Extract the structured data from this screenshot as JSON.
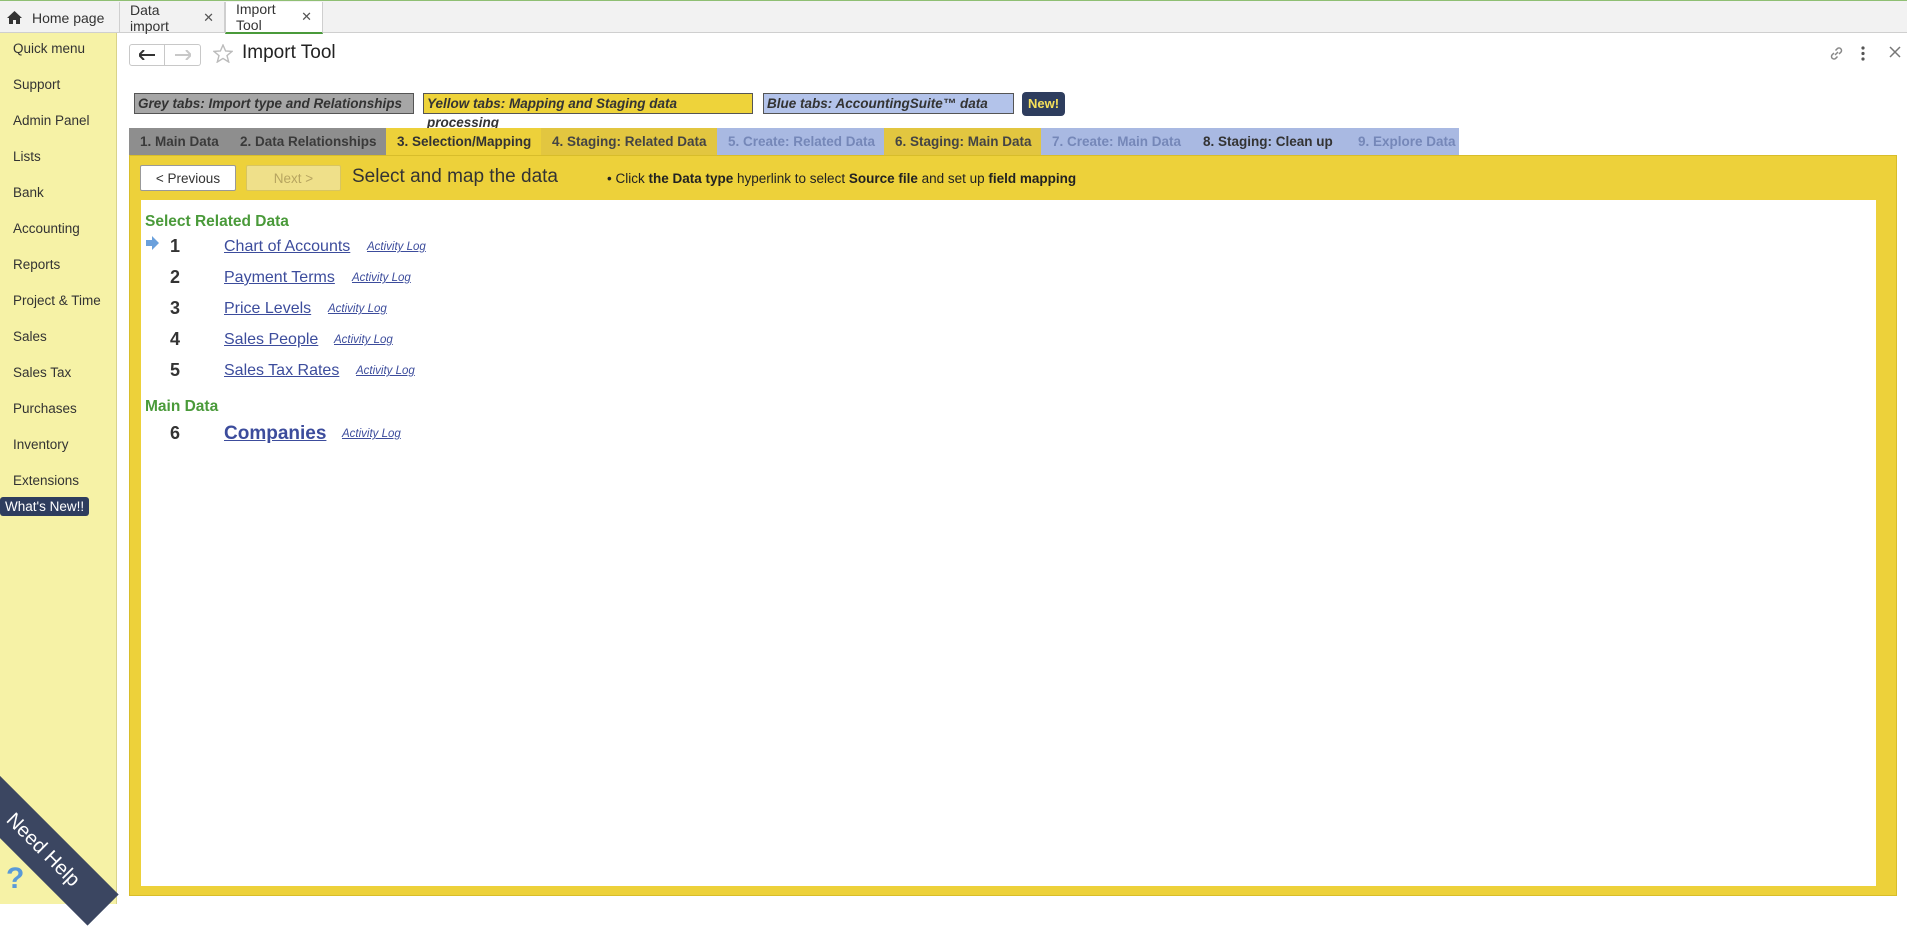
{
  "top_tabs": [
    {
      "label": "Home page"
    },
    {
      "label": "Data import"
    },
    {
      "label": "Import Tool"
    }
  ],
  "sidebar": {
    "items": [
      "Quick menu",
      "Support",
      "Admin Panel",
      "Lists",
      "Bank",
      "Accounting",
      "Reports",
      "Project & Time",
      "Sales",
      "Sales Tax",
      "Purchases",
      "Inventory",
      "Extensions"
    ],
    "whats_new": "What's New!!",
    "need_help": "Need Help",
    "need_help_icon": "?"
  },
  "header": {
    "title": "Import Tool"
  },
  "legend": {
    "grey": "Grey tabs: Import type and Relationships",
    "yellow": "Yellow tabs: Mapping and Staging data processing",
    "blue": "Blue tabs: AccountingSuite™ data",
    "new_badge": "New!"
  },
  "steps": [
    {
      "label": "1. Main Data"
    },
    {
      "label": "2. Data Relationships"
    },
    {
      "label": "3. Selection/Mapping"
    },
    {
      "label": "4. Staging: Related Data"
    },
    {
      "label": "5. Create: Related Data"
    },
    {
      "label": "6. Staging: Main Data"
    },
    {
      "label": "7. Create: Main Data"
    },
    {
      "label": "8. Staging: Clean up"
    },
    {
      "label": "9. Explore Data"
    }
  ],
  "toolbar": {
    "previous_label": "< Previous",
    "next_label": "Next >",
    "section_title": "Select and map the data",
    "hint_parts": [
      "• Click ",
      "the Data type",
      " hyperlink to select ",
      "Source file",
      " and set up ",
      "field mapping"
    ]
  },
  "groups": {
    "related_title": "Select Related Data",
    "main_title": "Main Data"
  },
  "rows": [
    {
      "num": "1",
      "label": "Chart of Accounts",
      "log": "Activity Log"
    },
    {
      "num": "2",
      "label": "Payment Terms",
      "log": "Activity Log"
    },
    {
      "num": "3",
      "label": "Price Levels",
      "log": "Activity Log"
    },
    {
      "num": "4",
      "label": "Sales People",
      "log": "Activity Log"
    },
    {
      "num": "5",
      "label": "Sales Tax Rates",
      "log": "Activity Log"
    },
    {
      "num": "6",
      "label": "Companies",
      "log": "Activity Log"
    }
  ],
  "colors": {
    "sidebar_bg": "#f6f2a6",
    "panel_yellow": "#edd13a",
    "accent_green": "#4a9a3a",
    "link_blue": "#3c4c9c"
  }
}
